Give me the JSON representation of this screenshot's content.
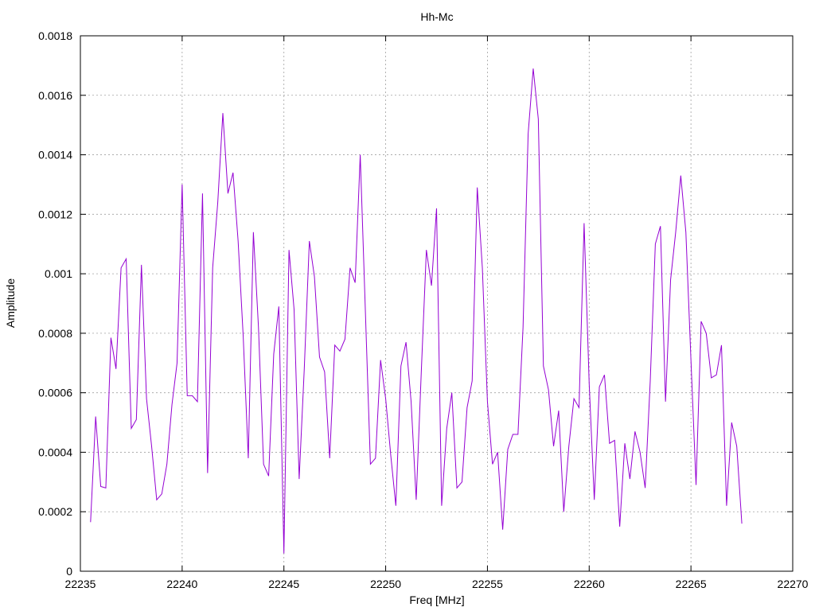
{
  "chart_data": {
    "type": "line",
    "title": "Hh-Mc",
    "xlabel": "Freq [MHz]",
    "ylabel": "Amplitude",
    "xlim": [
      22235,
      22270
    ],
    "ylim": [
      0,
      0.0018
    ],
    "x_ticks": [
      22235,
      22240,
      22245,
      22250,
      22255,
      22260,
      22265,
      22270
    ],
    "x_tick_labels": [
      "22235",
      "22240",
      "22245",
      "22250",
      "22255",
      "22260",
      "22265",
      "22270"
    ],
    "y_ticks": [
      0,
      0.0002,
      0.0004,
      0.0006,
      0.0008,
      0.001,
      0.0012,
      0.0014,
      0.0016,
      0.0018
    ],
    "y_tick_labels": [
      "0",
      "0.0002",
      "0.0004",
      "0.0006",
      "0.0008",
      "0.001",
      "0.0012",
      "0.0014",
      "0.0016",
      "0.0018"
    ],
    "grid": true,
    "series": [
      {
        "color": "#9400d3",
        "x": [
          22235.5,
          22235.75,
          22236,
          22236.25,
          22236.5,
          22236.75,
          22237,
          22237.25,
          22237.5,
          22237.75,
          22238,
          22238.25,
          22238.5,
          22238.75,
          22239,
          22239.25,
          22239.5,
          22239.75,
          22240,
          22240.25,
          22240.5,
          22240.75,
          22241,
          22241.25,
          22241.5,
          22241.75,
          22242,
          22242.25,
          22242.5,
          22242.75,
          22243,
          22243.25,
          22243.5,
          22243.75,
          22244,
          22244.25,
          22244.5,
          22244.75,
          22245,
          22245.25,
          22245.5,
          22245.75,
          22246,
          22246.25,
          22246.5,
          22246.75,
          22247,
          22247.25,
          22247.5,
          22247.75,
          22248,
          22248.25,
          22248.5,
          22248.75,
          22249,
          22249.25,
          22249.5,
          22249.75,
          22250,
          22250.25,
          22250.5,
          22250.75,
          22251,
          22251.25,
          22251.5,
          22251.75,
          22252,
          22252.25,
          22252.5,
          22252.75,
          22253,
          22253.25,
          22253.5,
          22253.75,
          22254,
          22254.25,
          22254.5,
          22254.75,
          22255,
          22255.25,
          22255.5,
          22255.75,
          22256,
          22256.25,
          22256.5,
          22256.75,
          22257,
          22257.25,
          22257.5,
          22257.75,
          22258,
          22258.25,
          22258.5,
          22258.75,
          22259,
          22259.25,
          22259.5,
          22259.75,
          22260,
          22260.25,
          22260.5,
          22260.75,
          22261,
          22261.25,
          22261.5,
          22261.75,
          22262,
          22262.25,
          22262.5,
          22262.75,
          22263,
          22263.25,
          22263.5,
          22263.75,
          22264,
          22264.25,
          22264.5,
          22264.75,
          22265,
          22265.25,
          22265.5,
          22265.75,
          22266,
          22266.25,
          22266.5,
          22266.75,
          22267,
          22267.25,
          22267.5
        ],
        "y": [
          0.000165,
          0.00052,
          0.000285,
          0.00028,
          0.000785,
          0.00068,
          0.00102,
          0.00105,
          0.00048,
          0.00051,
          0.00103,
          0.00058,
          0.00042,
          0.00024,
          0.00026,
          0.00036,
          0.00056,
          0.0007,
          0.0013,
          0.00059,
          0.00059,
          0.00057,
          0.00127,
          0.00033,
          0.00102,
          0.00124,
          0.00154,
          0.00127,
          0.00134,
          0.00111,
          0.00079,
          0.00038,
          0.00114,
          0.00082,
          0.00036,
          0.00032,
          0.00073,
          0.00089,
          6e-05,
          0.00108,
          0.00088,
          0.00031,
          0.00068,
          0.00111,
          0.00099,
          0.00072,
          0.00067,
          0.00038,
          0.00076,
          0.00074,
          0.00078,
          0.00102,
          0.00097,
          0.0014,
          0.00088,
          0.00036,
          0.00038,
          0.00071,
          0.00058,
          0.00039,
          0.00022,
          0.00069,
          0.00077,
          0.00057,
          0.00024,
          0.00067,
          0.00108,
          0.00096,
          0.00122,
          0.00022,
          0.00048,
          0.0006,
          0.00028,
          0.0003,
          0.00055,
          0.00064,
          0.00129,
          0.00102,
          0.00057,
          0.00036,
          0.0004,
          0.00014,
          0.00041,
          0.00046,
          0.00046,
          0.00082,
          0.00147,
          0.00169,
          0.00152,
          0.00069,
          0.00061,
          0.00042,
          0.00054,
          0.0002,
          0.00042,
          0.00058,
          0.00055,
          0.00117,
          0.00063,
          0.00024,
          0.00062,
          0.00066,
          0.00043,
          0.00044,
          0.00015,
          0.00043,
          0.00031,
          0.00047,
          0.0004,
          0.00028,
          0.00064,
          0.0011,
          0.00116,
          0.00057,
          0.00098,
          0.00114,
          0.00133,
          0.00114,
          0.00071,
          0.00029,
          0.00084,
          0.0008,
          0.00065,
          0.00066,
          0.00076,
          0.00022,
          0.0005,
          0.00042,
          0.00016
        ]
      }
    ]
  }
}
